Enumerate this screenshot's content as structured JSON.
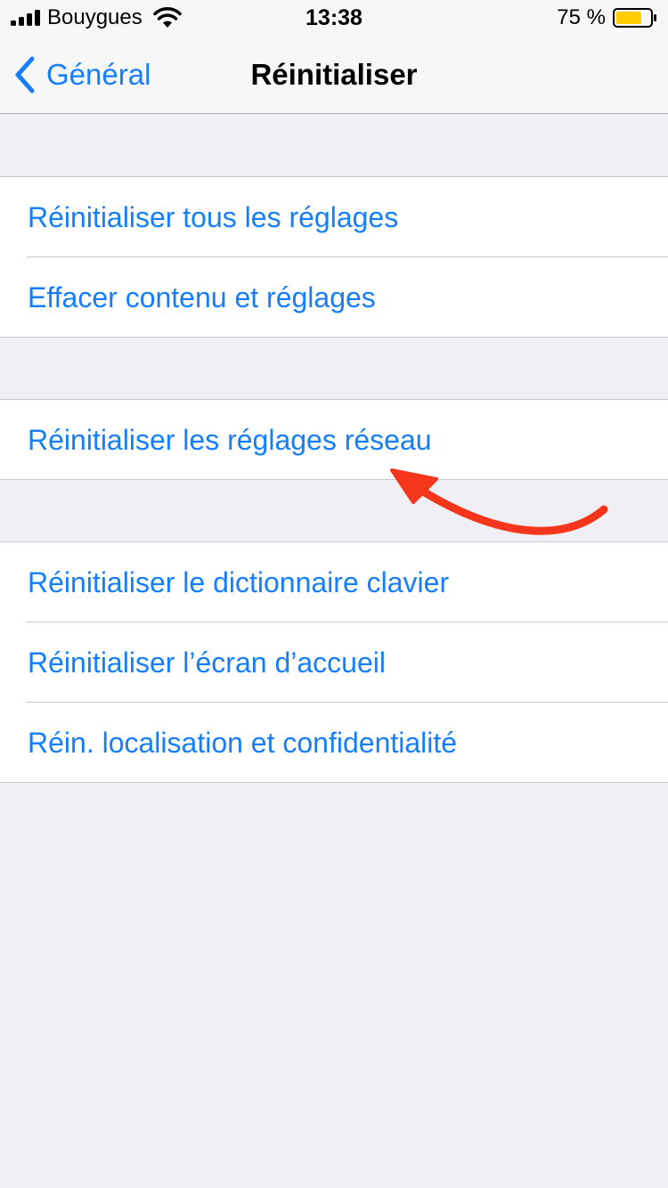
{
  "status_bar": {
    "carrier": "Bouygues",
    "time": "13:38",
    "battery_percent": "75 %",
    "battery_level": 0.75,
    "battery_color": "#ffcc00",
    "icons": [
      "signal-icon",
      "wifi-icon",
      "battery-icon"
    ]
  },
  "nav": {
    "back_label": "Général",
    "title": "Réinitialiser",
    "back_icon": "chevron-left-icon"
  },
  "groups": [
    {
      "items": [
        {
          "label": "Réinitialiser tous les réglages"
        },
        {
          "label": "Effacer contenu et réglages"
        }
      ]
    },
    {
      "items": [
        {
          "label": "Réinitialiser les réglages réseau"
        }
      ]
    },
    {
      "items": [
        {
          "label": "Réinitialiser le dictionnaire clavier"
        },
        {
          "label": "Réinitialiser l’écran d’accueil"
        },
        {
          "label": "Réin. localisation et confidentialité"
        }
      ]
    }
  ],
  "colors": {
    "accent": "#157efb",
    "background": "#efeff4",
    "annotation": "#f5361c"
  }
}
